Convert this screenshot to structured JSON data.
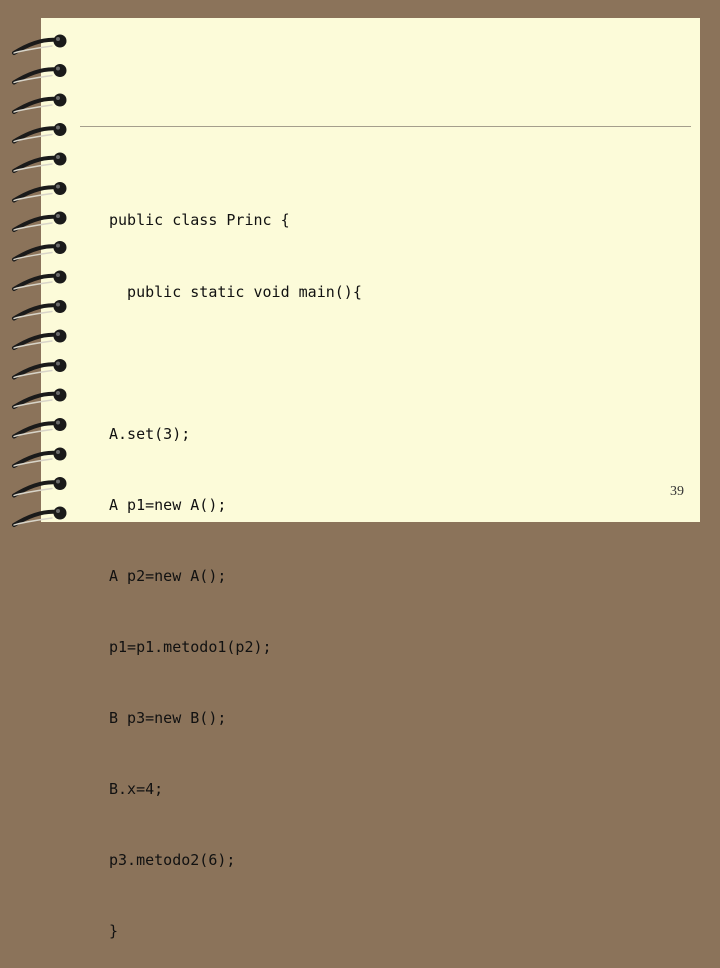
{
  "slide": {
    "code_lines": [
      "public class Princ {",
      "  public static void main(){",
      "",
      "A.set(3);",
      "A p1=new A();",
      "A p2=new A();",
      "p1=p1.metodo1(p2);",
      "B p3=new B();",
      "B.x=4;",
      "p3.metodo2(6);",
      "}"
    ],
    "page_number": "39"
  },
  "colors": {
    "background": "#8b735a",
    "paper": "#fcfbd9",
    "rule": "#a49e8c",
    "ring": "#1a1a1a"
  },
  "icons": [
    "spiral-ring-icon"
  ]
}
